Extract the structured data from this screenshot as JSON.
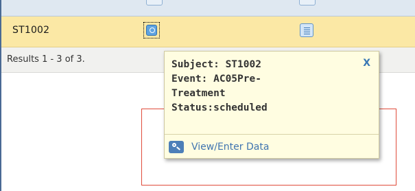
{
  "table": {
    "row": {
      "subject_id": "ST1002"
    },
    "results_text": "Results 1 - 3 of 3."
  },
  "popup": {
    "lines": [
      "Subject: ST1002",
      "Event: AC05Pre-",
      "Treatment",
      "Status:scheduled"
    ],
    "close_label": "X",
    "action_label": "View/Enter Data",
    "action_icon": "key-icon"
  },
  "colors": {
    "row_highlight": "#fbe8a5",
    "popup_background": "#fffde1",
    "link_blue": "#3f74b0",
    "annotation_red": "#e04b3a"
  }
}
